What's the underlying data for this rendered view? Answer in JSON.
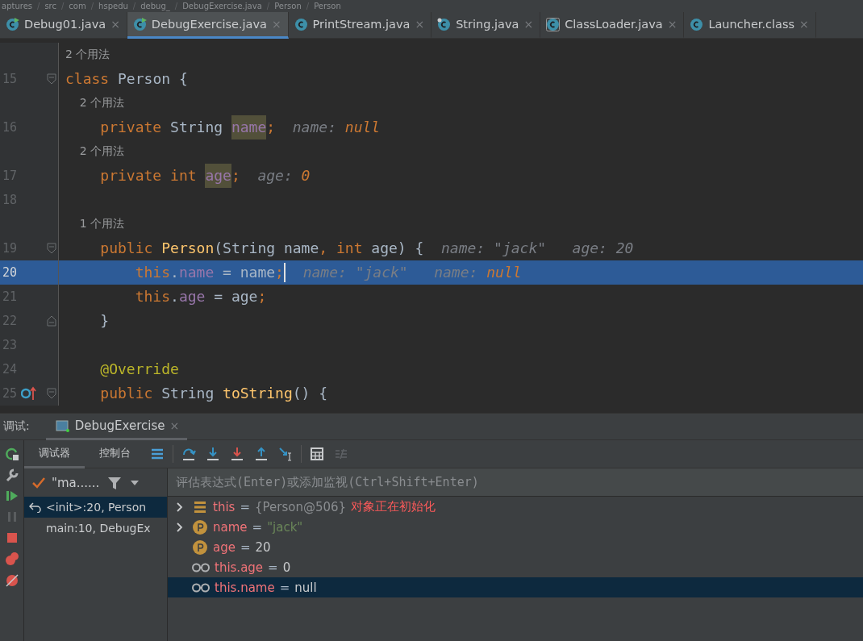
{
  "breadcrumb": [
    "aptures",
    "/",
    "src",
    "/",
    "com",
    "/",
    "hspedu",
    "/",
    "debug_",
    "/",
    "DebugExercise.java",
    "/",
    "Person",
    "/",
    "Person"
  ],
  "tabs": [
    {
      "label": "Debug01.java",
      "kind": "running",
      "close": "×",
      "selected": false
    },
    {
      "label": "DebugExercise.java",
      "kind": "running",
      "close": "×",
      "selected": true
    },
    {
      "label": "PrintStream.java",
      "kind": "plain",
      "close": "×",
      "selected": false
    },
    {
      "label": "String.java",
      "kind": "pinned",
      "close": "×",
      "selected": false
    },
    {
      "label": "ClassLoader.java",
      "kind": "compiled",
      "close": "×",
      "selected": false
    },
    {
      "label": "Launcher.class",
      "kind": "plain",
      "close": "×",
      "selected": false
    }
  ],
  "editor": {
    "lines": [
      {
        "number": "15",
        "usage": "2 个用法",
        "kind": "opener",
        "selected": false,
        "tokens": [
          {
            "kind": "keyword",
            "text": "class "
          },
          {
            "kind": "plain",
            "text": "Person {"
          }
        ]
      },
      {
        "number": "16",
        "usage": "2 个用法",
        "kind": "plain",
        "selected": false,
        "tokens": [
          {
            "kind": "keyword",
            "text": "    private "
          },
          {
            "kind": "plain",
            "text": "String "
          },
          {
            "kind": "usage",
            "text": "name"
          },
          {
            "kind": "keyword",
            "text": ";"
          },
          {
            "kind": "hint",
            "text": "  name: "
          },
          {
            "kind": "value",
            "text": "null"
          }
        ]
      },
      {
        "number": "17",
        "usage": "2 个用法",
        "kind": "plain",
        "selected": false,
        "tokens": [
          {
            "kind": "keyword",
            "text": "    private int "
          },
          {
            "kind": "usage",
            "text": "age"
          },
          {
            "kind": "keyword",
            "text": ";"
          },
          {
            "kind": "hint",
            "text": "  age: "
          },
          {
            "kind": "value",
            "text": "0"
          }
        ]
      },
      {
        "number": "18",
        "kind": "plain",
        "selected": false
      },
      {
        "number": "19",
        "usage": "1 个用法",
        "kind": "opener",
        "selected": false,
        "tokens": [
          {
            "kind": "keyword",
            "text": "    public "
          },
          {
            "kind": "method",
            "text": "Person"
          },
          {
            "kind": "plain",
            "text": "(String name"
          },
          {
            "kind": "keyword",
            "text": ", int "
          },
          {
            "kind": "plain",
            "text": "age) {"
          },
          {
            "kind": "hint",
            "text": "  name: \"jack\"   age: 20"
          }
        ]
      },
      {
        "number": "20",
        "kind": "plain",
        "selected": true,
        "tokens": [
          {
            "kind": "keyword",
            "text": "        this"
          },
          {
            "kind": "plain",
            "text": "."
          },
          {
            "kind": "field",
            "text": "name"
          },
          {
            "kind": "plain",
            "text": " = name"
          },
          {
            "kind": "keyword",
            "text": ";"
          },
          {
            "kind": "caret"
          },
          {
            "kind": "hint",
            "text": "  name: \"jack\"   name: "
          },
          {
            "kind": "value",
            "text": "null"
          }
        ]
      },
      {
        "number": "21",
        "kind": "plain",
        "selected": false,
        "tokens": [
          {
            "kind": "keyword",
            "text": "        this"
          },
          {
            "kind": "plain",
            "text": "."
          },
          {
            "kind": "field",
            "text": "age"
          },
          {
            "kind": "plain",
            "text": " = age"
          },
          {
            "kind": "keyword",
            "text": ";"
          }
        ]
      },
      {
        "number": "22",
        "kind": "closer",
        "selected": false,
        "tokens": [
          {
            "kind": "plain",
            "text": "    }"
          }
        ]
      },
      {
        "number": "23",
        "kind": "plain",
        "selected": false
      },
      {
        "number": "24",
        "kind": "plain",
        "selected": false,
        "tokens": [
          {
            "kind": "annotation",
            "text": "    @Override"
          }
        ]
      },
      {
        "number": "25",
        "kind": "override",
        "selected": false,
        "tokens": [
          {
            "kind": "keyword",
            "text": "    public "
          },
          {
            "kind": "plain",
            "text": "String "
          },
          {
            "kind": "method",
            "text": "toString"
          },
          {
            "kind": "plain",
            "text": "() {"
          }
        ]
      }
    ]
  },
  "debug": {
    "title": "调试:",
    "session_tab": "DebugExercise",
    "session_close": "×",
    "subtabs": [
      {
        "label": "调试器",
        "selected": true
      },
      {
        "label": "控制台",
        "selected": false
      }
    ],
    "thread": "\"ma......",
    "frames": [
      {
        "label": "<init>:20, Person",
        "selected": true
      },
      {
        "label": "main:10, DebugEx",
        "selected": false
      }
    ],
    "eval_placeholder": "评估表达式(Enter)或添加监视(Ctrl+Shift+Enter)",
    "variables": [
      {
        "kind": "object",
        "expandable": true,
        "selected": false,
        "name": "this",
        "operator": "=",
        "value": {
          "kind": "reference",
          "text": "{Person@506}"
        },
        "note": "对象正在初始化"
      },
      {
        "kind": "parameter",
        "expandable": true,
        "selected": false,
        "name": "name",
        "operator": "=",
        "value": {
          "kind": "string",
          "text": "\"jack\""
        }
      },
      {
        "kind": "parameter",
        "expandable": false,
        "selected": false,
        "name": "age",
        "operator": "=",
        "value": {
          "kind": "plain",
          "text": "20"
        }
      },
      {
        "kind": "watch",
        "expandable": false,
        "selected": false,
        "name": "this.age",
        "operator": "=",
        "value": {
          "kind": "plain",
          "text": "0"
        }
      },
      {
        "kind": "watch",
        "expandable": false,
        "selected": true,
        "name": "this.name",
        "operator": "=",
        "value": {
          "kind": "plain",
          "text": "null"
        }
      }
    ]
  }
}
